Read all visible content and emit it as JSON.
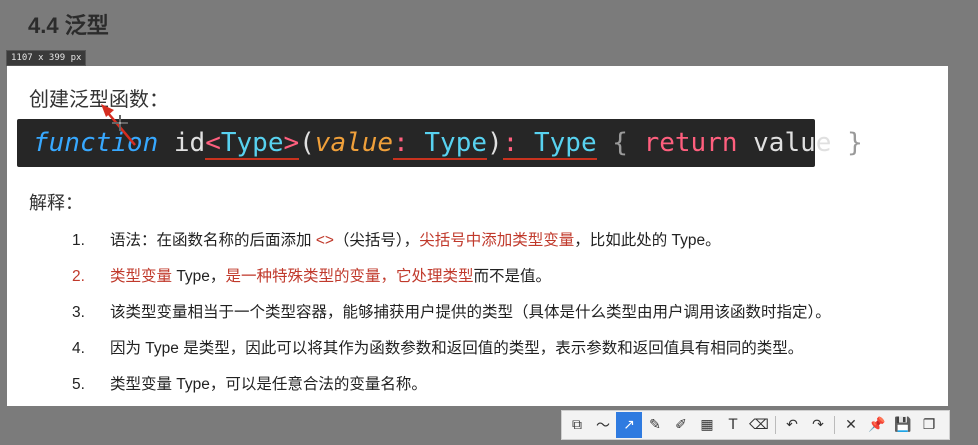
{
  "heading": "4.4 泛型",
  "dimension_badge": "1107 x 399  px",
  "slide": {
    "title": "创建泛型函数：",
    "code": {
      "function_kw": "function",
      "fn_name": " id",
      "lt": "<",
      "type_param": "Type",
      "gt": ">",
      "lparen": "(",
      "param": "value",
      "colon1": ":",
      "param_type": " Type",
      "rparen": ")",
      "colon2": ":",
      "return_type": " Type",
      "lbrace": " {",
      "return_kw": " return",
      "return_val": " value",
      "rbrace": " }"
    },
    "explain_label": "解释：",
    "points": [
      {
        "num": "1.",
        "a": "语法：在函数名称的后面添加 ",
        "b": "<>",
        "c": "（尖括号），",
        "d": "尖括号中添加类型变量",
        "e": "，比如此处的 Type。"
      },
      {
        "num": "2.",
        "a": "类型变量",
        "b": " Type，",
        "c": "是一种特殊类型的变量，它处理类型",
        "d": "而不是值。"
      },
      {
        "num": "3.",
        "text": "该类型变量相当于一个类型容器，能够捕获用户提供的类型（具体是什么类型由用户调用该函数时指定）。"
      },
      {
        "num": "4.",
        "text": "因为 Type 是类型，因此可以将其作为函数参数和返回值的类型，表示参数和返回值具有相同的类型。"
      },
      {
        "num": "5.",
        "text": "类型变量 Type，可以是任意合法的变量名称。"
      }
    ]
  },
  "colors": {
    "accent_red": "#c0392b",
    "toolbar_active": "#2f7be0"
  },
  "toolbar": {
    "tools": [
      {
        "name": "rectangle-select-tool-icon",
        "glyph": "⧉"
      },
      {
        "name": "freehand-line-tool-icon",
        "glyph": "〜"
      },
      {
        "name": "arrow-tool-icon",
        "glyph": "↗",
        "active": true
      },
      {
        "name": "pen-tool-icon",
        "glyph": "✎"
      },
      {
        "name": "highlighter-tool-icon",
        "glyph": "✐"
      },
      {
        "name": "mosaic-tool-icon",
        "glyph": "▦"
      },
      {
        "name": "text-tool-icon",
        "glyph": "T"
      },
      {
        "name": "eraser-tool-icon",
        "glyph": "⌫"
      },
      {
        "name": "undo-icon",
        "glyph": "↶"
      },
      {
        "name": "redo-icon",
        "glyph": "↷"
      },
      {
        "name": "close-icon",
        "glyph": "✕"
      },
      {
        "name": "pin-icon",
        "glyph": "📌"
      },
      {
        "name": "save-icon",
        "glyph": "💾"
      },
      {
        "name": "copy-icon",
        "glyph": "❐"
      }
    ]
  }
}
